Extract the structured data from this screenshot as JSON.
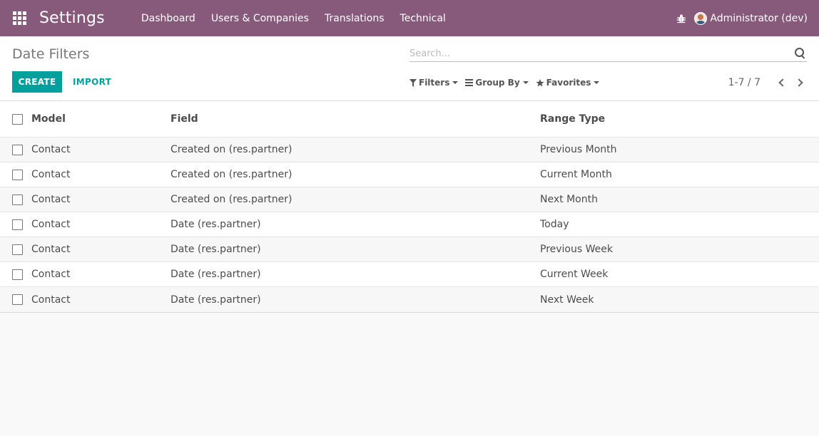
{
  "topbar": {
    "app_title": "Settings",
    "menu": [
      "Dashboard",
      "Users & Companies",
      "Translations",
      "Technical"
    ],
    "user": "Administrator (dev)",
    "color": "#875a7b"
  },
  "control_panel": {
    "breadcrumb": "Date Filters",
    "create_label": "CREATE",
    "import_label": "IMPORT",
    "search_placeholder": "Search...",
    "filters_label": "Filters",
    "groupby_label": "Group By",
    "favorites_label": "Favorites",
    "pager": "1-7 / 7",
    "accent_color": "#00a09d"
  },
  "table": {
    "headers": {
      "model": "Model",
      "field": "Field",
      "range": "Range Type"
    },
    "rows": [
      {
        "model": "Contact",
        "field": "Created on (res.partner)",
        "range": "Previous Month"
      },
      {
        "model": "Contact",
        "field": "Created on (res.partner)",
        "range": "Current Month"
      },
      {
        "model": "Contact",
        "field": "Created on (res.partner)",
        "range": "Next Month"
      },
      {
        "model": "Contact",
        "field": "Date (res.partner)",
        "range": "Today"
      },
      {
        "model": "Contact",
        "field": "Date (res.partner)",
        "range": "Previous Week"
      },
      {
        "model": "Contact",
        "field": "Date (res.partner)",
        "range": "Current Week"
      },
      {
        "model": "Contact",
        "field": "Date (res.partner)",
        "range": "Next Week"
      }
    ]
  }
}
